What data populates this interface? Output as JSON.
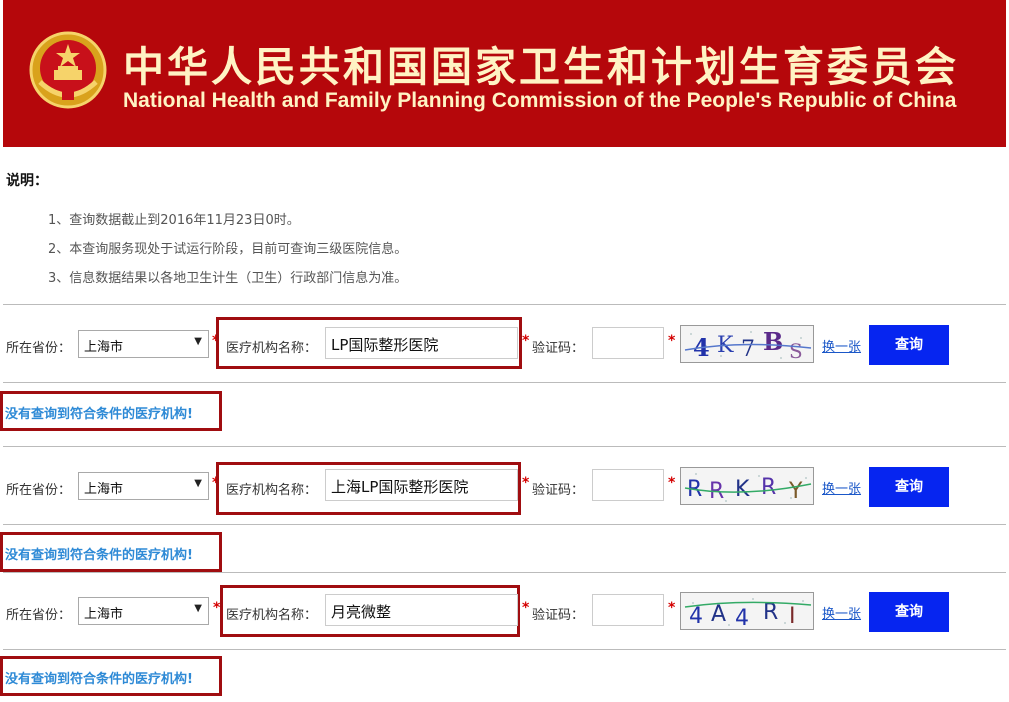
{
  "header": {
    "title_cn": "中华人民共和国国家卫生和计划生育委员会",
    "title_en": "National Health and Family Planning Commission of the People's Republic of China",
    "emblem_icon": "national-emblem-icon",
    "bg_color": "#b5070b"
  },
  "notes": {
    "title": "说明：",
    "items": [
      "1、查询数据截止到2016年11月23日0时。",
      "2、本查询服务现处于试运行阶段，目前可查询三级医院信息。",
      "3、信息数据结果以各地卫生计生（卫生）行政部门信息为准。"
    ]
  },
  "queries": [
    {
      "province_label": "所在省份：",
      "province_value": "上海市",
      "name_label": "医疗机构名称：",
      "name_value": "LP国际整形医院",
      "code_label": "验证码：",
      "code_value": "",
      "captcha_text": "4K7BS",
      "swap_label": "换一张",
      "search_label": "查询",
      "result": "没有查询到符合条件的医疗机构!"
    },
    {
      "province_label": "所在省份：",
      "province_value": "上海市",
      "name_label": "医疗机构名称：",
      "name_value": "上海LP国际整形医院",
      "code_label": "验证码：",
      "code_value": "",
      "captcha_text": "RRKRY",
      "swap_label": "换一张",
      "search_label": "查询",
      "result": "没有查询到符合条件的医疗机构!"
    },
    {
      "province_label": "所在省份：",
      "province_value": "上海市",
      "name_label": "医疗机构名称：",
      "name_value": "月亮微整",
      "code_label": "验证码：",
      "code_value": "",
      "captcha_text": "4A4RI",
      "swap_label": "换一张",
      "search_label": "查询",
      "result": "没有查询到符合条件的医疗机构!"
    }
  ],
  "colors": {
    "accent_red": "#a00d10",
    "button_blue": "#0625f0",
    "result_blue": "#2e8ad6",
    "link_blue": "#1a57c8"
  }
}
